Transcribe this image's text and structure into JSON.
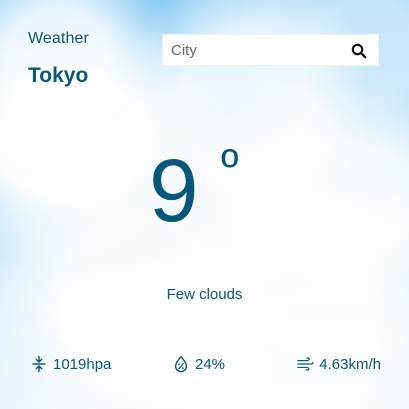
{
  "app": {
    "title": "Weather"
  },
  "location": {
    "city": "Tokyo"
  },
  "search": {
    "placeholder": "City"
  },
  "current": {
    "temperature": "9",
    "degree_symbol": "º",
    "description": "Few clouds"
  },
  "stats": {
    "pressure": {
      "value": "1019hpa",
      "icon": "pressure-icon"
    },
    "humidity": {
      "value": "24%",
      "icon": "humidity-icon"
    },
    "wind": {
      "value": "4.63km/h",
      "icon": "wind-icon"
    }
  },
  "colors": {
    "text": "#06577a",
    "search_background": "#ffffff"
  }
}
